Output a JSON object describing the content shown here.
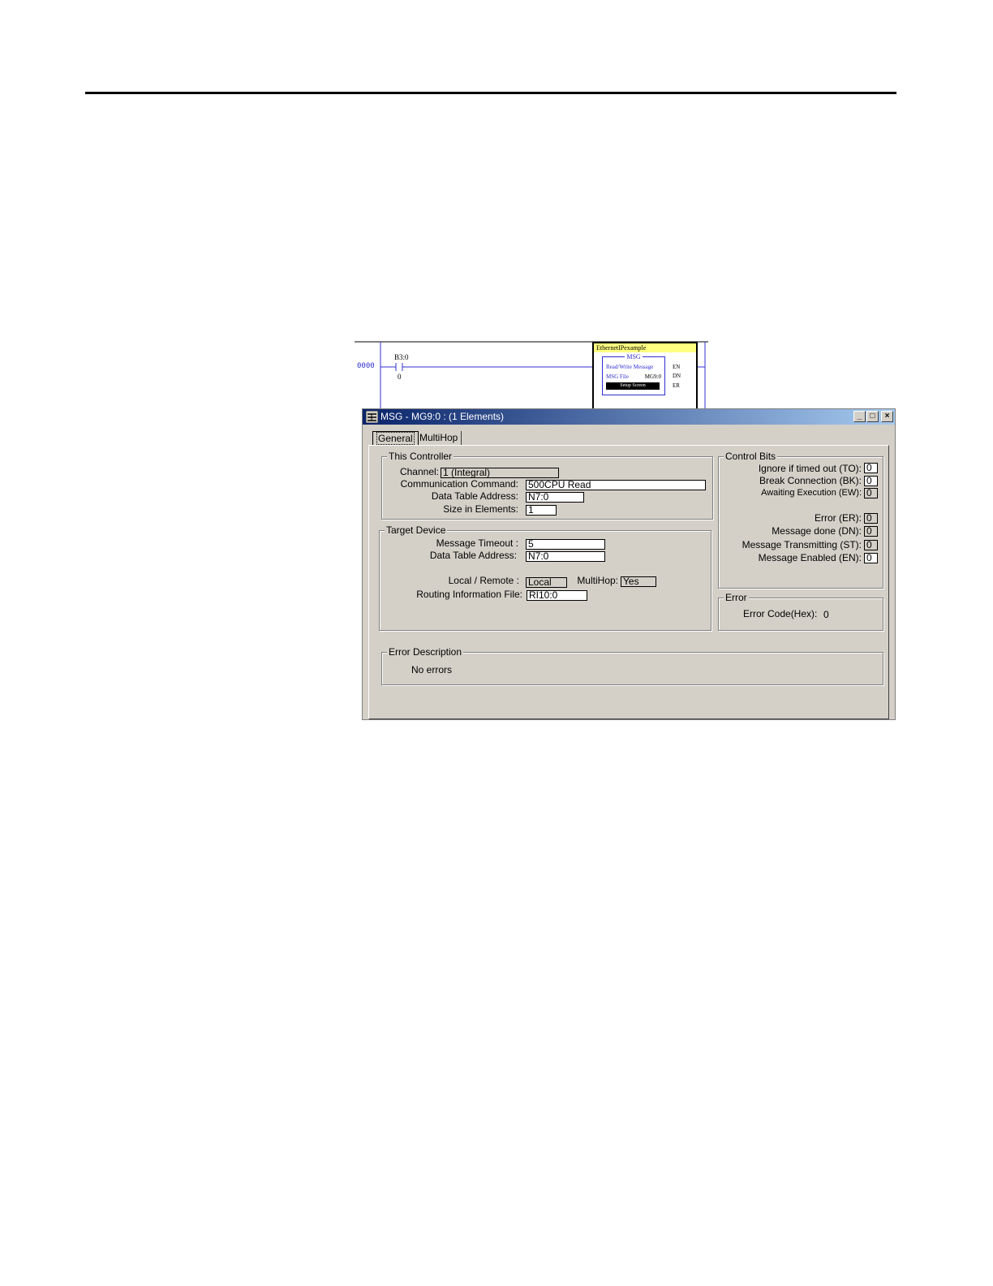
{
  "ladder": {
    "rung_number": "0000",
    "contact_address": "B3:0",
    "contact_bit": "0",
    "instruction_tag": "EthernetIPexample",
    "instruction_name": "MSG",
    "instruction_desc": "Read/Write Message",
    "msg_file_label": "MSG File",
    "msg_file_value": "MG9:0",
    "setup_screen_label": "Setup Screen",
    "coils": [
      "EN",
      "DN",
      "ER"
    ]
  },
  "dialog": {
    "title": "MSG - MG9:0 : (1 Elements)",
    "buttons": {
      "minimize": "_",
      "maximize": "□",
      "close": "×"
    },
    "tabs": [
      "General",
      "MultiHop"
    ],
    "this_controller": {
      "title": "This Controller",
      "channel_label": "Channel:",
      "channel_value": "1 (Integral)",
      "command_label": "Communication Command:",
      "command_value": "500CPU Read",
      "data_table_label": "Data Table Address:",
      "data_table_value": "N7:0",
      "size_label": "Size in Elements:",
      "size_value": "1"
    },
    "target_device": {
      "title": "Target Device",
      "timeout_label": "Message Timeout :",
      "timeout_value": "5",
      "data_table_label": "Data Table Address:",
      "data_table_value": "N7:0",
      "local_remote_label": "Local / Remote :",
      "local_remote_value": "Local",
      "multihop_label": "MultiHop:",
      "multihop_value": "Yes",
      "routing_label": "Routing Information File:",
      "routing_value": "RI10:0"
    },
    "control_bits": {
      "title": "Control Bits",
      "items": [
        {
          "label": "Ignore if timed out (TO):",
          "value": "0"
        },
        {
          "label": "Break Connection (BK):",
          "value": "0"
        },
        {
          "label": "Awaiting Execution (EW):",
          "value": "0"
        },
        {
          "label": "Error (ER):",
          "value": "0"
        },
        {
          "label": "Message done (DN):",
          "value": "0"
        },
        {
          "label": "Message Transmitting (ST):",
          "value": "0"
        },
        {
          "label": "Message Enabled (EN):",
          "value": "0"
        }
      ]
    },
    "error": {
      "title": "Error",
      "code_label": "Error Code(Hex):",
      "code_value": "0"
    },
    "error_description": {
      "title": "Error Description",
      "text": "No errors"
    }
  }
}
